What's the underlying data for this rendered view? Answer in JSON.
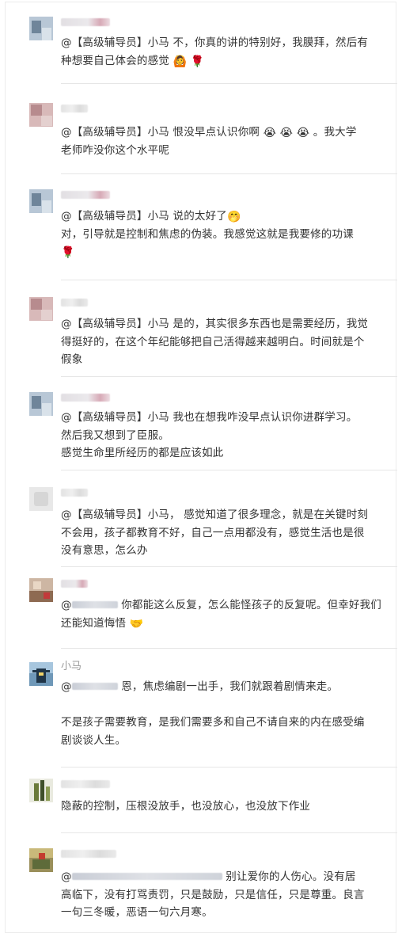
{
  "comments": [
    {
      "name": "",
      "lines": [
        "@【高级辅导员】小马 不，你真的讲的特别好，我膜拜，然后有",
        "种想要自己体会的感觉"
      ],
      "emoji_end": [
        "🙆",
        "🌹"
      ]
    },
    {
      "name": "",
      "lines": [
        "@【高级辅导员】小马 恨没早点认识你啊",
        "老师咋没你这个水平呢"
      ],
      "line1_emoji": [
        "😭",
        "😭",
        "😭"
      ],
      "line1_tail": "。我大学"
    },
    {
      "name": "",
      "lines": [
        "@【高级辅导员】小马 说的太好了",
        "对，引导就是控制和焦虑的伪装。我感觉这就是我要修的功课"
      ],
      "line1_emoji": [
        "🤭"
      ],
      "line3_emoji": [
        "🌹"
      ]
    },
    {
      "name": "",
      "lines": [
        "@【高级辅导员】小马 是的，其实很多东西也是需要经历，我觉",
        "得挺好的，在这个年纪能够把自己活得越来越明白。时间就是个",
        "假象"
      ]
    },
    {
      "name": "",
      "lines": [
        "@【高级辅导员】小马 我也在想我咋没早点认识你进群学习。",
        "然后我又想到了臣服。",
        "感觉生命里所经历的都是应该如此"
      ]
    },
    {
      "name": "",
      "lines": [
        "@【高级辅导员】小马，  感觉知道了很多理念，就是在关键时刻",
        "不会用，孩子都教育不好，自己一点用都没有，感觉生活也是很",
        "没有意思，怎么办"
      ]
    },
    {
      "name": "",
      "lines": [
        "你都能这么反复，怎么能怪孩子的反复呢。但幸好我们",
        "还能知道悔悟"
      ],
      "emoji_end": [
        "🤝"
      ]
    },
    {
      "name": "小马",
      "lines": [
        "恩，焦虑编剧一出手，我们就跟着剧情来走。",
        "",
        "不是孩子需要教育，是我们需要多和自己不请自来的内在感受编",
        "剧谈谈人生。"
      ]
    },
    {
      "name": "",
      "lines": [
        "隐蔽的控制，压根没放手，也没放心，也没放下作业"
      ]
    },
    {
      "name": "",
      "lines": [
        "别让爱你的人伤心。没有居",
        "高临下，没有打骂责罚，只是鼓励，只是信任，只是尊重。良言",
        "一句三冬暖，恶语一句六月寒。"
      ]
    }
  ],
  "at_prefix": "@"
}
